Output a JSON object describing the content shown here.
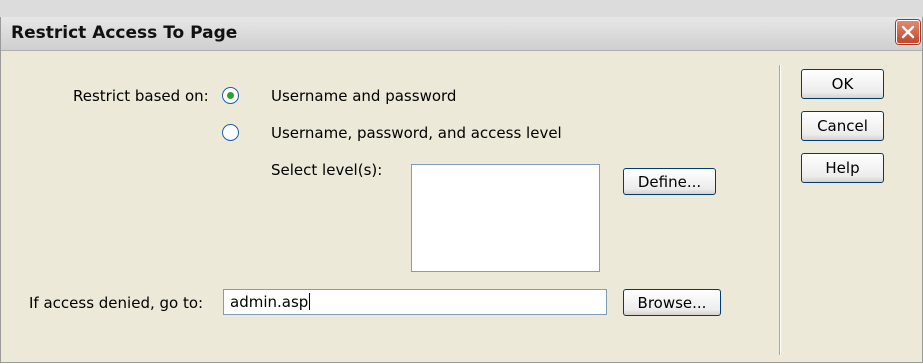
{
  "dialog": {
    "title": "Restrict Access To Page",
    "restrict_label": "Restrict based on:",
    "options": [
      {
        "label": "Username and password",
        "selected": true
      },
      {
        "label": "Username, password, and access level",
        "selected": false
      }
    ],
    "select_levels_label": "Select level(s):",
    "define_button": "Define...",
    "denied_label": "If access denied, go to:",
    "denied_value": "admin.asp",
    "browse_button": "Browse...",
    "ok_button": "OK",
    "cancel_button": "Cancel",
    "help_button": "Help"
  },
  "colors": {
    "dialog_bg": "#ece9d8",
    "close_button": "#c4452a",
    "radio_selected": "#2ca02c"
  },
  "icons": {
    "close": "close-icon"
  }
}
